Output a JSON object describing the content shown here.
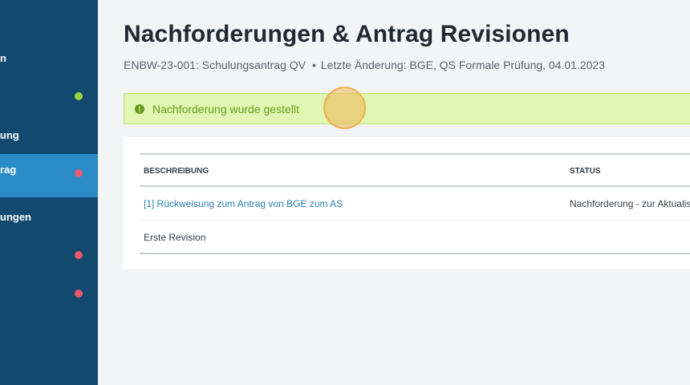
{
  "sidebar": {
    "items": [
      {
        "label": "n",
        "status": ""
      },
      {
        "label": "",
        "status": "green"
      },
      {
        "label": "ung",
        "status": ""
      },
      {
        "label": "rag",
        "status": "red",
        "active": true
      },
      {
        "label": "ungen",
        "status": ""
      },
      {
        "label": "",
        "status": "red"
      },
      {
        "label": "",
        "status": "red"
      }
    ]
  },
  "page": {
    "title": "Nachforderungen & Antrag Revisionen",
    "meta_left": "ENBW-23-001: Schulungsantrag QV",
    "meta_sep": "•",
    "meta_right": "Letzte Änderung: BGE, QS Formale Prüfung, 04.01.2023"
  },
  "alert": {
    "icon": "exclamation-circle-icon",
    "icon_glyph": "!",
    "text": "Nachforderung wurde gestellt"
  },
  "table": {
    "headers": [
      "BESCHREIBUNG",
      "STATUS"
    ],
    "rows": [
      {
        "description": "[1] Rückweisung zum Antrag von BGE zum AS",
        "status": "Nachforderung - zur Aktualisi"
      },
      {
        "description": "Erste Revision",
        "status": ""
      }
    ]
  },
  "colors": {
    "sidebar": "#114a6e",
    "sidebar_active": "#2a8bc7",
    "alert_bg": "#e0f7b3",
    "alert_text": "#6a9a20",
    "link": "#2a7fb5",
    "dot_green": "#9bd43d",
    "dot_red": "#e8576a"
  }
}
